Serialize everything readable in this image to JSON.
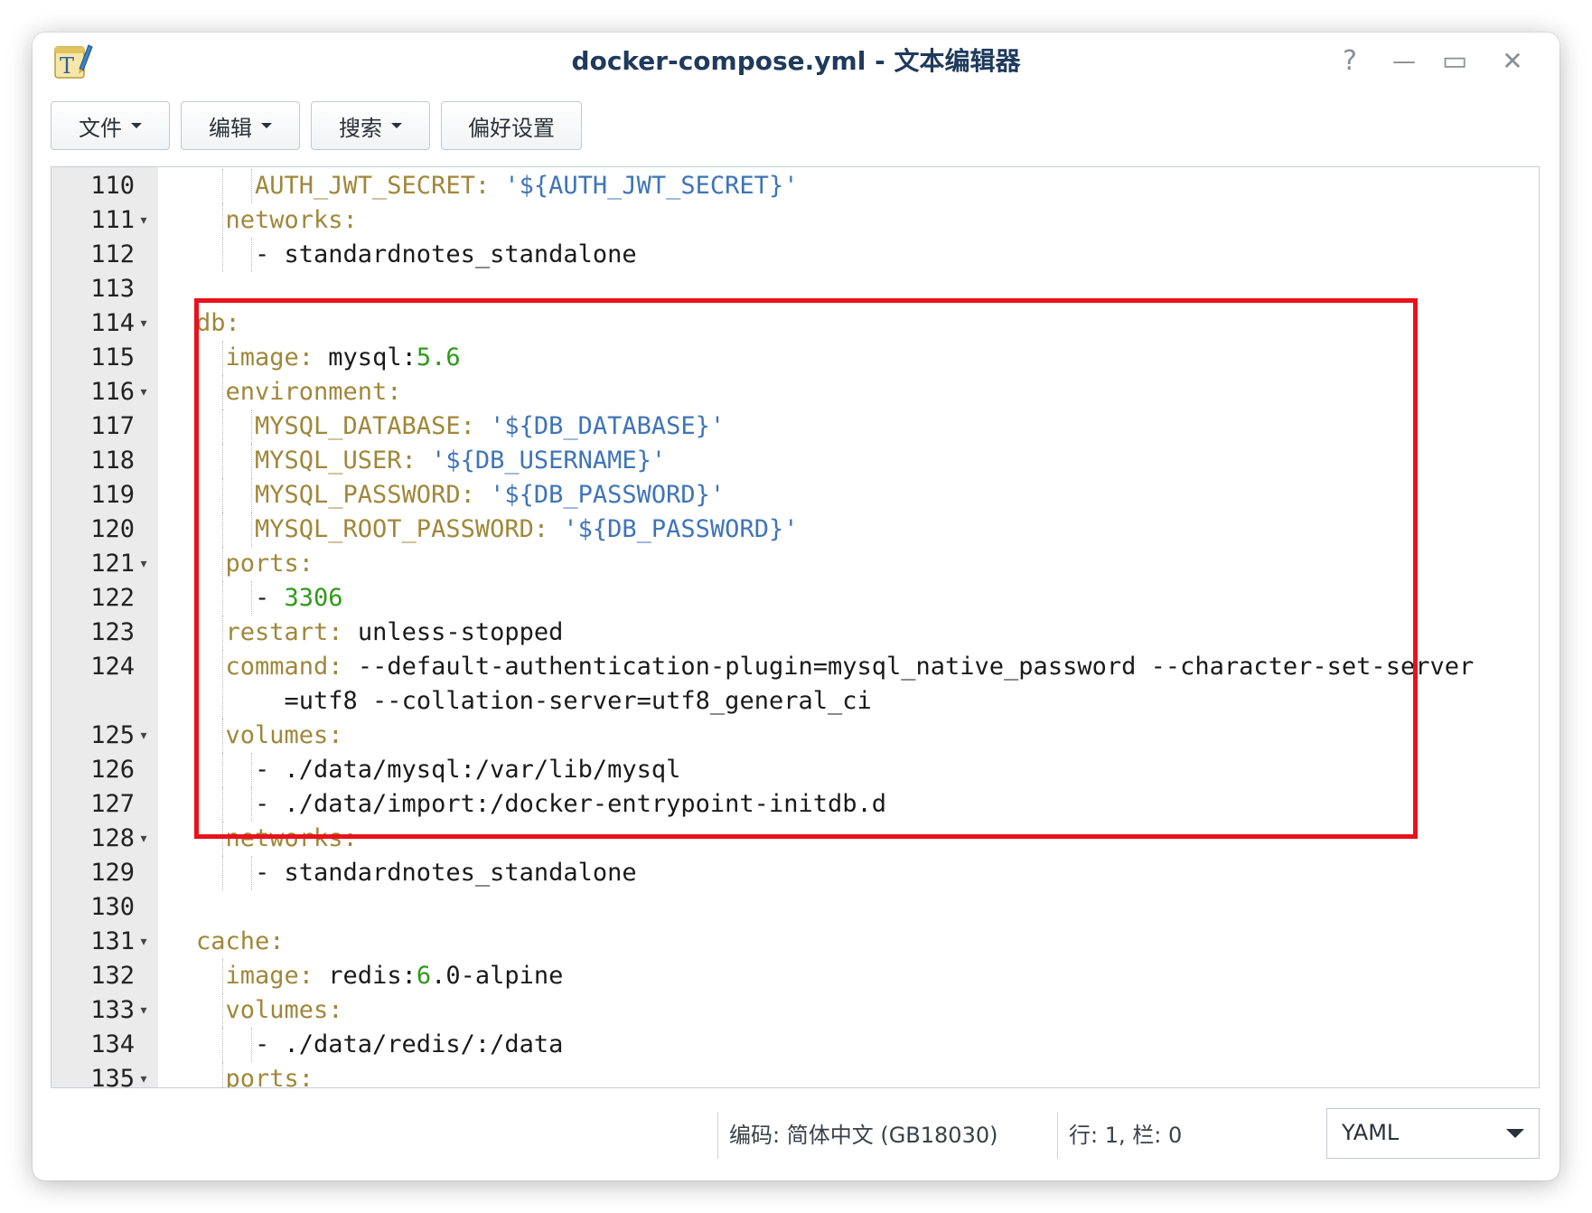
{
  "window": {
    "title": "docker-compose.yml - 文本编辑器",
    "help_glyph": "?",
    "minimize_glyph": "—",
    "maximize_glyph": "▭",
    "close_glyph": "✕"
  },
  "toolbar": {
    "file": "文件",
    "edit": "编辑",
    "search": "搜索",
    "preferences": "偏好设置"
  },
  "editor": {
    "lines": [
      {
        "num": "110",
        "indent": 4,
        "fold": false,
        "tokens": [
          {
            "t": "AUTH_JWT_SECRET: ",
            "c": "k"
          },
          {
            "t": "'${AUTH_JWT_SECRET}'",
            "c": "s"
          }
        ]
      },
      {
        "num": "111",
        "indent": 2,
        "fold": true,
        "tokens": [
          {
            "t": "networks:",
            "c": "k"
          }
        ]
      },
      {
        "num": "112",
        "indent": 4,
        "fold": false,
        "tokens": [
          {
            "t": "- standardnotes_standalone",
            "c": ""
          }
        ]
      },
      {
        "num": "113",
        "indent": 0,
        "fold": false,
        "tokens": []
      },
      {
        "num": "114",
        "indent": 0,
        "fold": true,
        "tokens": [
          {
            "t": "db:",
            "c": "k"
          }
        ]
      },
      {
        "num": "115",
        "indent": 2,
        "fold": false,
        "tokens": [
          {
            "t": "image: ",
            "c": "k"
          },
          {
            "t": "mysql:",
            "c": ""
          },
          {
            "t": "5.6",
            "c": "n"
          }
        ]
      },
      {
        "num": "116",
        "indent": 2,
        "fold": true,
        "tokens": [
          {
            "t": "environment:",
            "c": "k"
          }
        ]
      },
      {
        "num": "117",
        "indent": 4,
        "fold": false,
        "tokens": [
          {
            "t": "MYSQL_DATABASE: ",
            "c": "k"
          },
          {
            "t": "'${DB_DATABASE}'",
            "c": "s"
          }
        ]
      },
      {
        "num": "118",
        "indent": 4,
        "fold": false,
        "tokens": [
          {
            "t": "MYSQL_USER: ",
            "c": "k"
          },
          {
            "t": "'${DB_USERNAME}'",
            "c": "s"
          }
        ]
      },
      {
        "num": "119",
        "indent": 4,
        "fold": false,
        "tokens": [
          {
            "t": "MYSQL_PASSWORD: ",
            "c": "k"
          },
          {
            "t": "'${DB_PASSWORD}'",
            "c": "s"
          }
        ]
      },
      {
        "num": "120",
        "indent": 4,
        "fold": false,
        "tokens": [
          {
            "t": "MYSQL_ROOT_PASSWORD: ",
            "c": "k"
          },
          {
            "t": "'${DB_PASSWORD}'",
            "c": "s"
          }
        ]
      },
      {
        "num": "121",
        "indent": 2,
        "fold": true,
        "tokens": [
          {
            "t": "ports:",
            "c": "k"
          }
        ]
      },
      {
        "num": "122",
        "indent": 4,
        "fold": false,
        "tokens": [
          {
            "t": "- ",
            "c": ""
          },
          {
            "t": "3306",
            "c": "n"
          }
        ]
      },
      {
        "num": "123",
        "indent": 2,
        "fold": false,
        "tokens": [
          {
            "t": "restart: ",
            "c": "k"
          },
          {
            "t": "unless-stopped",
            "c": ""
          }
        ]
      },
      {
        "num": "124",
        "indent": 2,
        "fold": false,
        "wrap": true,
        "tokens": [
          {
            "t": "command: ",
            "c": "k"
          },
          {
            "t": "--default-authentication-plugin=mysql_native_password --character-set-server\n    =utf8 --collation-server=utf8_general_ci",
            "c": ""
          }
        ]
      },
      {
        "num": "125",
        "indent": 2,
        "fold": true,
        "tokens": [
          {
            "t": "volumes:",
            "c": "k"
          }
        ]
      },
      {
        "num": "126",
        "indent": 4,
        "fold": false,
        "tokens": [
          {
            "t": "- ./data/mysql:/var/lib/mysql",
            "c": ""
          }
        ]
      },
      {
        "num": "127",
        "indent": 4,
        "fold": false,
        "tokens": [
          {
            "t": "- ./data/import:/docker-entrypoint-initdb.d",
            "c": ""
          }
        ]
      },
      {
        "num": "128",
        "indent": 2,
        "fold": true,
        "tokens": [
          {
            "t": "networks:",
            "c": "k"
          }
        ]
      },
      {
        "num": "129",
        "indent": 4,
        "fold": false,
        "tokens": [
          {
            "t": "- standardnotes_standalone",
            "c": ""
          }
        ]
      },
      {
        "num": "130",
        "indent": 0,
        "fold": false,
        "tokens": []
      },
      {
        "num": "131",
        "indent": 0,
        "fold": true,
        "tokens": [
          {
            "t": "cache:",
            "c": "k"
          }
        ]
      },
      {
        "num": "132",
        "indent": 2,
        "fold": false,
        "tokens": [
          {
            "t": "image: ",
            "c": "k"
          },
          {
            "t": "redis:",
            "c": ""
          },
          {
            "t": "6",
            "c": "n"
          },
          {
            "t": ".0-alpine",
            "c": ""
          }
        ]
      },
      {
        "num": "133",
        "indent": 2,
        "fold": true,
        "tokens": [
          {
            "t": "volumes:",
            "c": "k"
          }
        ]
      },
      {
        "num": "134",
        "indent": 4,
        "fold": false,
        "tokens": [
          {
            "t": "- ./data/redis/:/data",
            "c": ""
          }
        ]
      },
      {
        "num": "135",
        "indent": 2,
        "fold": true,
        "tokens": [
          {
            "t": "ports:",
            "c": "k"
          }
        ]
      }
    ]
  },
  "status": {
    "encoding": "编码: 简体中文 (GB18030)",
    "position": "行: 1, 栏: 0",
    "language": "YAML"
  },
  "colors": {
    "key": "#a0873a",
    "string": "#3f74b8",
    "number": "#2f9a1b",
    "highlight_border": "#e8121c"
  },
  "icons": {
    "app": "text-editor-icon",
    "help": "help-icon",
    "minimize": "minimize-icon",
    "maximize": "maximize-icon",
    "close": "close-icon",
    "dropdown": "chevron-down-icon"
  }
}
